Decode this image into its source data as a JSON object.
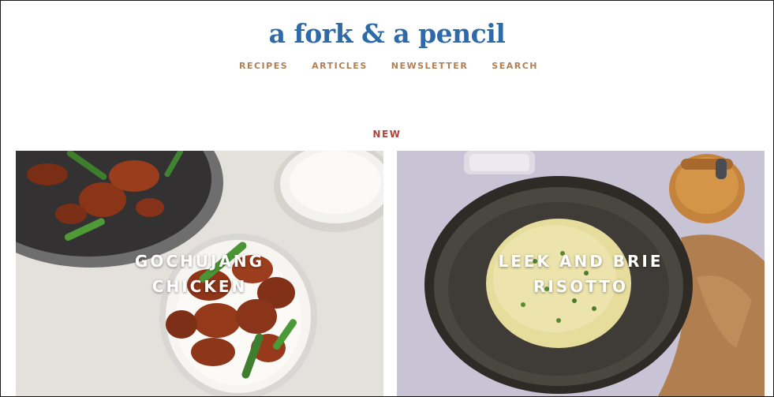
{
  "site": {
    "logo": "a fork & a pencil"
  },
  "nav": {
    "items": [
      {
        "label": "RECIPES"
      },
      {
        "label": "ARTICLES"
      },
      {
        "label": "NEWSLETTER"
      },
      {
        "label": "SEARCH"
      }
    ]
  },
  "section": {
    "label": "NEW"
  },
  "cards": [
    {
      "title": "GOCHUJANG CHICKEN",
      "image": "gochujang-chicken-photo"
    },
    {
      "title": "LEEK AND BRIE RISOTTO",
      "image": "leek-brie-risotto-photo"
    }
  ],
  "colors": {
    "logo": "#2f6aa8",
    "nav": "#b07f55",
    "section_label": "#b0433a",
    "card_title": "#ffffff"
  }
}
